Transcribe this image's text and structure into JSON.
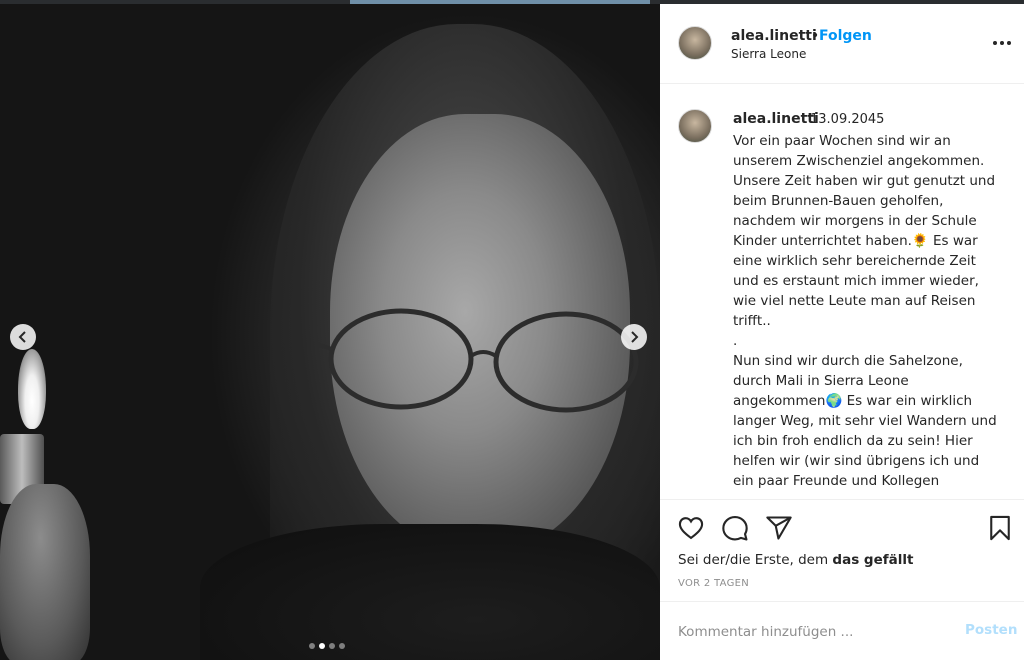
{
  "post": {
    "username": "alea.linetti",
    "separator": "•",
    "follow_label": "Folgen",
    "location": "Sierra Leone",
    "date": "13.09.2045",
    "caption": "Vor ein paar Wochen sind wir an unserem Zwischenziel angekommen. Unsere Zeit haben wir gut genutzt und beim Brunnen-Bauen geholfen, nachdem wir morgens in der Schule Kinder unterrichtet haben.🌻 Es war eine wirklich sehr bereichernde Zeit und es erstaunt mich immer wieder, wie viel nette Leute man auf Reisen trifft..\n.\nNun sind wir durch die Sahelzone, durch Mali in Sierra Leone angekommen🌍 Es war ein wirklich langer Weg, mit sehr viel Wandern und ich bin froh endlich da zu sein! Hier helfen wir (wir sind übrigens ich und ein paar Freunde und Kollegen",
    "likes_prefix": "Sei der/die Erste, dem ",
    "likes_bold": "das gefällt",
    "time_ago": "VOR 2 TAGEN",
    "comment_placeholder": "Kommentar hinzufügen ...",
    "post_label": "Posten"
  },
  "carousel": {
    "slide_count": 4,
    "active_index": 1
  },
  "colors": {
    "accent": "#0095f6",
    "post_disabled": "#b2dffc",
    "text": "#262626",
    "muted": "#8e8e8e"
  },
  "icons": {
    "prev": "chevron-left-icon",
    "next": "chevron-right-icon",
    "like": "heart-icon",
    "comment": "comment-icon",
    "share": "paper-plane-icon",
    "save": "bookmark-icon",
    "more": "more-horizontal-icon"
  }
}
